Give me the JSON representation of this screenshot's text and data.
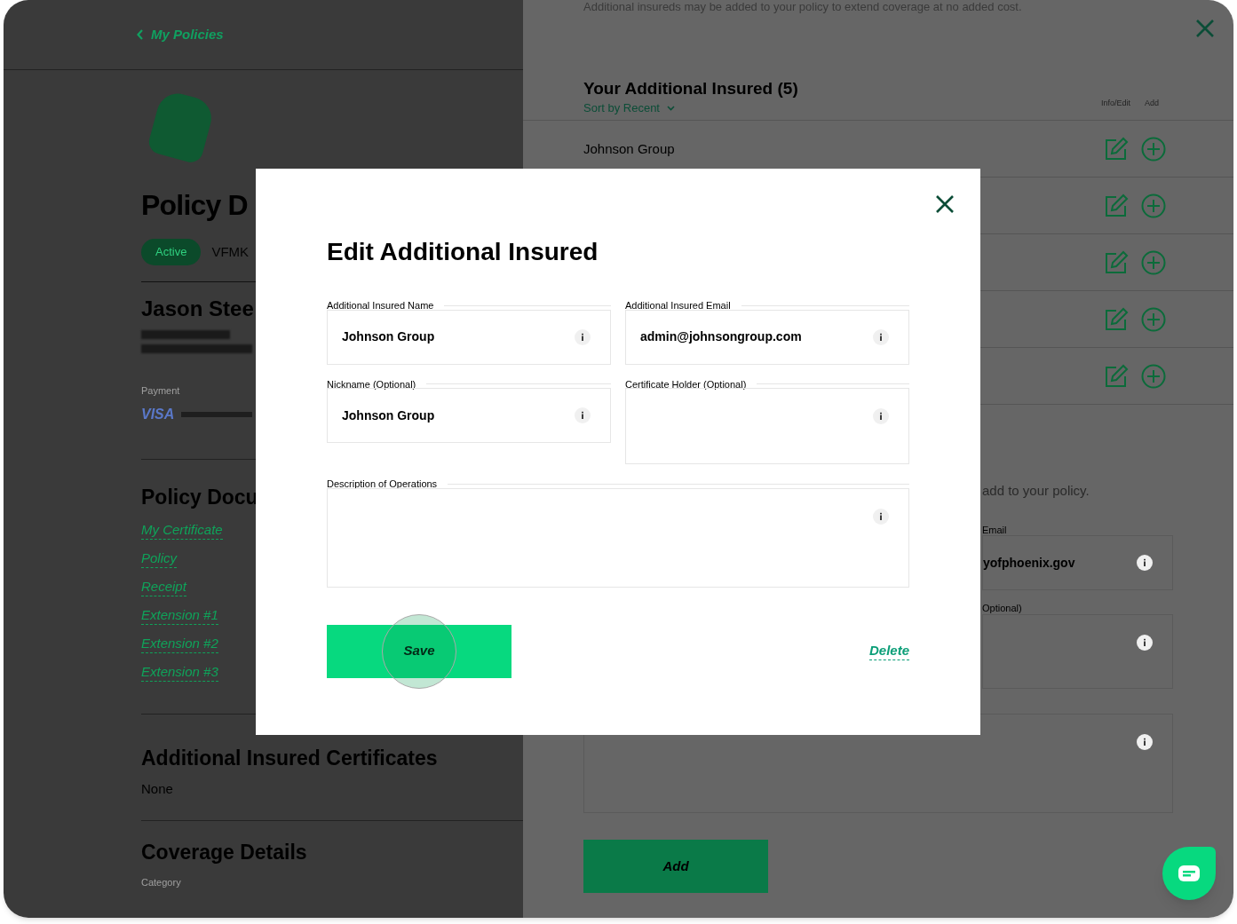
{
  "back_link": "My Policies",
  "policy": {
    "title": "Policy D",
    "status": "Active",
    "number": "VFMK",
    "holder": "Jason Stee",
    "payment_label": "Payment",
    "card_brand": "VISA"
  },
  "documents": {
    "title": "Policy Docu",
    "links": [
      "My Certificate",
      "Policy",
      "Receipt",
      "Extension #1",
      "Extension #2",
      "Extension #3"
    ]
  },
  "certificates": {
    "title": "Additional Insured Certificates",
    "value": "None"
  },
  "coverage": {
    "title": "Coverage Details",
    "first_label": "Category"
  },
  "insured_panel": {
    "intro": "Additional insureds may be added to your policy to extend coverage at no added cost.",
    "title": "Your Additional Insured (5)",
    "sort": "Sort by Recent",
    "col_edit": "Info/Edit",
    "col_add": "Add",
    "rows": [
      {
        "name": "Johnson Group"
      },
      {},
      {},
      {},
      {}
    ],
    "add_text": "add to your policy.",
    "email_label": "Email",
    "email_value": "yofphoenix.gov",
    "holder_label": "Optional)",
    "add_button": "Add"
  },
  "modal": {
    "title": "Edit Additional Insured",
    "fields": [
      {
        "label": "Additional Insured Name",
        "value": "Johnson Group",
        "kind": "input"
      },
      {
        "label": "Additional Insured Email",
        "value": "admin@johnsongroup.com",
        "kind": "input"
      },
      {
        "label": "Nickname (Optional)",
        "value": "Johnson Group",
        "kind": "input"
      },
      {
        "label": "Certificate Holder (Optional)",
        "kind": "textarea"
      },
      {
        "label": "Description of Operations",
        "kind": "wide-textarea"
      }
    ],
    "save": "Save",
    "delete": "Delete"
  }
}
